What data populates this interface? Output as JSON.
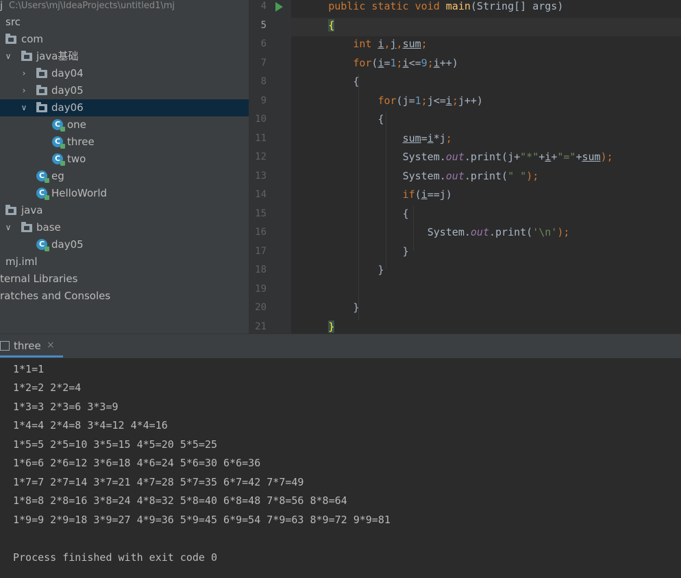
{
  "tree": {
    "root_path": "C:\\Users\\mj\\IdeaProjects\\untitled1\\mj",
    "root_label": "j",
    "items": [
      {
        "label": "src"
      },
      {
        "label": "com"
      },
      {
        "label": "java基础"
      },
      {
        "label": "day04"
      },
      {
        "label": "day05"
      },
      {
        "label": "day06"
      },
      {
        "label": "one"
      },
      {
        "label": "three"
      },
      {
        "label": "two"
      },
      {
        "label": "eg"
      },
      {
        "label": "HelloWorld"
      },
      {
        "label": "java"
      },
      {
        "label": "base"
      },
      {
        "label": "day05"
      },
      {
        "label": "mj.iml"
      },
      {
        "label": "ternal Libraries"
      },
      {
        "label": "ratches and Consoles"
      }
    ]
  },
  "editor": {
    "current_line": 5,
    "line_numbers": [
      "4",
      "5",
      "6",
      "7",
      "8",
      "9",
      "10",
      "11",
      "12",
      "13",
      "14",
      "15",
      "16",
      "17",
      "18",
      "19",
      "20",
      "21"
    ],
    "lines": {
      "l4": {
        "kw": "public static void ",
        "fn": "main",
        "rest": "(String[] args)"
      },
      "l5": {
        "brace": "{"
      },
      "l6": {
        "kw": "int ",
        "v1": "i",
        "c1": ",",
        "v2": "j",
        "c2": ",",
        "v3": "sum",
        "end": ";"
      },
      "l7": {
        "kw": "for",
        "p1": "(",
        "v1": "i",
        "eq": "=",
        "n1": "1",
        "s1": ";",
        "v2": "i",
        "lt": "<=",
        "n2": "9",
        "s2": ";",
        "v3": "i",
        "pp": "++)"
      },
      "l8": {
        "t": "{"
      },
      "l9": {
        "kw": "for",
        "p1": "(",
        "v1": "j",
        "eq": "=",
        "n1": "1",
        "s1": ";",
        "v2": "j",
        "lt": "<=",
        "v3": "i",
        "s2": ";",
        "v4": "j",
        "pp": "++)"
      },
      "l10": {
        "t": "{"
      },
      "l11": {
        "v1": "sum",
        "eq": "=",
        "v2": "i",
        "mul": "*",
        "v3": "j",
        "end": ";"
      },
      "l12": {
        "a": "System.",
        "f": "out",
        "b": ".print(j+",
        "s1": "\"*\"",
        "c": "+",
        "v1": "i",
        "d": "+",
        "s2": "\"=\"",
        "e": "+",
        "v2": "sum",
        "end": ");"
      },
      "l13": {
        "a": "System.",
        "f": "out",
        "b": ".print(",
        "s1": "\" \"",
        "end": ");"
      },
      "l14": {
        "kw": "if",
        "p1": "(",
        "v1": "i",
        "eq": "==",
        "v2": "j",
        "p2": ")"
      },
      "l15": {
        "t": "{"
      },
      "l16": {
        "a": "System.",
        "f": "out",
        "b": ".print(",
        "s1": "'\\n'",
        "end": ");"
      },
      "l17": {
        "t": "}"
      },
      "l18": {
        "t": "}"
      },
      "l19": {
        "t": ""
      },
      "l20": {
        "t": "}"
      },
      "l21": {
        "brace": "}"
      }
    }
  },
  "run_panel": {
    "tab_label": "three",
    "tab_close": "×",
    "output": [
      "1*1=1",
      "1*2=2 2*2=4",
      "1*3=3 2*3=6 3*3=9",
      "1*4=4 2*4=8 3*4=12 4*4=16",
      "1*5=5 2*5=10 3*5=15 4*5=20 5*5=25",
      "1*6=6 2*6=12 3*6=18 4*6=24 5*6=30 6*6=36",
      "1*7=7 2*7=14 3*7=21 4*7=28 5*7=35 6*7=42 7*7=49",
      "1*8=8 2*8=16 3*8=24 4*8=32 5*8=40 6*8=48 7*8=56 8*8=64",
      "1*9=9 2*9=18 3*9=27 4*9=36 5*9=45 6*9=54 7*9=63 8*9=72 9*9=81",
      "",
      "Process finished with exit code 0"
    ]
  },
  "icons": {
    "folder": "folder-icon",
    "java_class": "java-class-icon",
    "run": "run-icon"
  },
  "colors": {
    "selection": "#0d293e",
    "keyword": "#cc7832",
    "number": "#6897bb",
    "string": "#6a8759",
    "method": "#ffc66d",
    "field": "#9876aa"
  }
}
